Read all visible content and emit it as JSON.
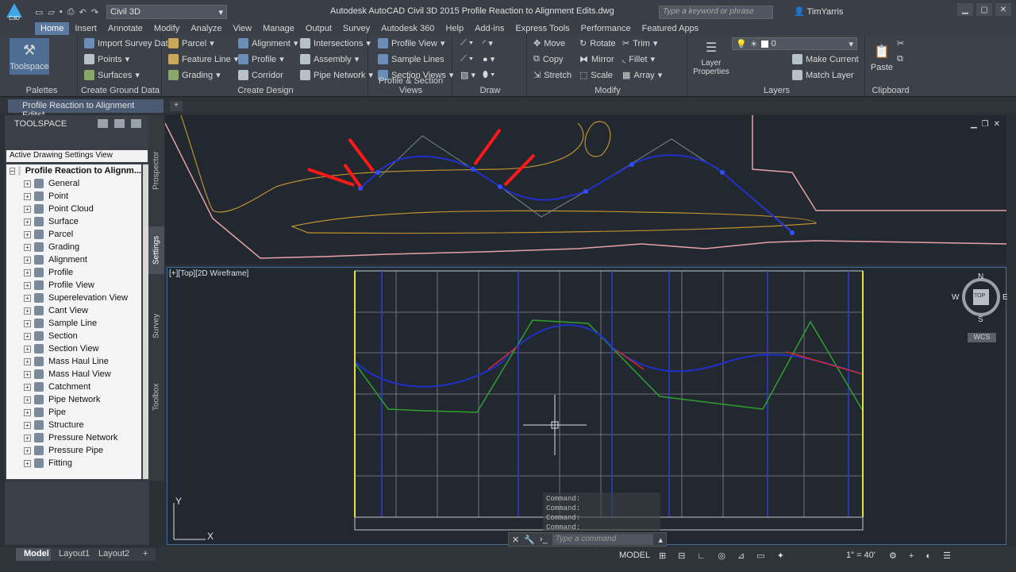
{
  "titlebar": {
    "app_badge": "C3D",
    "workspace": "Civil 3D",
    "title": "Autodesk AutoCAD Civil 3D 2015    Profile Reaction to Alignment Edits.dwg",
    "search_placeholder": "Type a keyword or phrase",
    "user": "TimYarris"
  },
  "menu_tabs": [
    "Home",
    "Insert",
    "Annotate",
    "Modify",
    "Analyze",
    "View",
    "Manage",
    "Output",
    "Survey",
    "Autodesk 360",
    "Help",
    "Add-ins",
    "Express Tools",
    "Performance",
    "Featured Apps"
  ],
  "ribbon": {
    "palettes": {
      "title": "Palettes",
      "toolspace": "Toolspace"
    },
    "create_ground": {
      "title": "Create Ground Data",
      "items": [
        "Import Survey Data",
        "Points",
        "Surfaces"
      ]
    },
    "create_design": {
      "title": "Create Design",
      "items": [
        "Parcel",
        "Feature Line",
        "Grading",
        "Alignment",
        "Profile",
        "Corridor",
        "Intersections",
        "Assembly",
        "Pipe Network"
      ]
    },
    "profile_views": {
      "title": "Profile & Section Views",
      "items": [
        "Profile View",
        "Sample Lines",
        "Section Views"
      ]
    },
    "draw": {
      "title": "Draw"
    },
    "modify": {
      "title": "Modify",
      "items": [
        "Move",
        "Copy",
        "Stretch",
        "Rotate",
        "Mirror",
        "Scale",
        "Trim",
        "Fillet",
        "Array"
      ]
    },
    "layers": {
      "title": "Layers",
      "layer_props": "Layer Properties",
      "current_layer": "0",
      "items": [
        "Make Current",
        "Match Layer"
      ]
    },
    "clipboard": {
      "title": "Clipboard",
      "paste": "Paste"
    }
  },
  "doc_tab": "Profile Reaction to Alignment Edits*",
  "toolspace": {
    "title": "TOOLSPACE",
    "view_select": "Active Drawing Settings View",
    "root": "Profile Reaction to Alignm...",
    "items": [
      "General",
      "Point",
      "Point Cloud",
      "Surface",
      "Parcel",
      "Grading",
      "Alignment",
      "Profile",
      "Profile View",
      "Superelevation View",
      "Cant View",
      "Sample Line",
      "Section",
      "Section View",
      "Mass Haul Line",
      "Mass Haul View",
      "Catchment",
      "Pipe Network",
      "Pipe",
      "Structure",
      "Pressure Network",
      "Pressure Pipe",
      "Fitting"
    ],
    "side_tabs": [
      "Prospector",
      "Settings",
      "Survey",
      "Toolbox"
    ]
  },
  "viewport": {
    "label": "[+][Top][2D Wireframe]",
    "compass": {
      "n": "N",
      "s": "S",
      "e": "E",
      "w": "W",
      "top": "TOP",
      "wcs": "WCS"
    },
    "axis_x": "X",
    "axis_y": "Y"
  },
  "command": {
    "history": [
      "Command:",
      "Command:",
      "Command:",
      "Command:"
    ],
    "placeholder": "Type a command"
  },
  "status": {
    "layouts": [
      "Model",
      "Layout1",
      "Layout2"
    ],
    "model": "MODEL",
    "scale": "1\" = 40'"
  }
}
